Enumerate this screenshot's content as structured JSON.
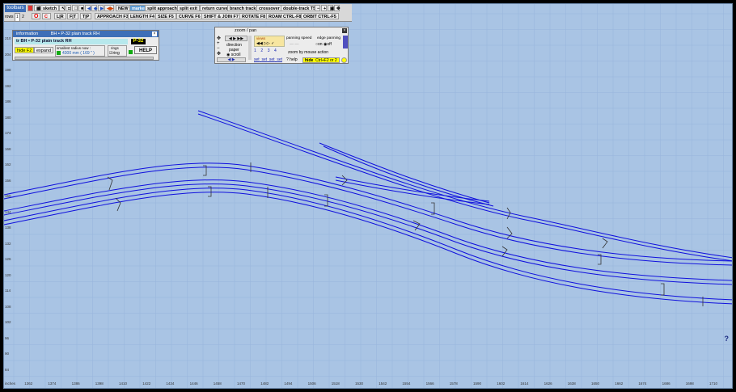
{
  "toolbar": {
    "title": "toolbars",
    "rows_label": "rows",
    "row_opts": [
      "1",
      "2"
    ],
    "sketch": "sketch",
    "new": "NEW",
    "marker": "marker",
    "split_approach": "split  approach",
    "split_exit": "split  exit",
    "return_curve": "return curve",
    "branch_track": "branch track",
    "crossover": "crossover",
    "double_track": "double-track  T5",
    "btn_o": "O",
    "btn_c": "C",
    "lr": "L|R",
    "fit": "F|T",
    "tip": "T|P",
    "approach": "APPROACH  F3",
    "length": "LENGTH  F4",
    "size": "SIZE  F5",
    "curve": "CURVE  F6",
    "shift_join": "SHIFT & JOIN  F7",
    "rotate": "ROTATE  F8",
    "roam": "ROAM  CTRL-F8",
    "orbit": "ORBIT  CTRL-F5"
  },
  "info": {
    "title": "information",
    "subtitle": "BH • P-32  plain track   RH",
    "line": "tr   BH • P-32  plain track   RH",
    "badge": "P-32",
    "hide": "hide  F2",
    "expand": "expand",
    "radius_label": "smallest  radius  now :",
    "radius_value": "4300 mm  ( 169 \" )",
    "rings_label": "rings",
    "ring": "ring",
    "help": "HELP"
  },
  "zoom": {
    "title": "zoom  /  pan",
    "direction": "direction",
    "paper": "paper",
    "scroll": "scroll",
    "views": "views",
    "panning_speed": "panning speed",
    "edge_panning": "edge panning",
    "on": "on",
    "off": "off",
    "set_labels": [
      "set",
      "set",
      "set",
      "set"
    ],
    "num_labels": [
      "1",
      "2",
      "3",
      "4"
    ],
    "zoom_by_mouse": "zoom  by  mouse  action",
    "help": "? help",
    "hide": "hide",
    "hide_key": "Ctrl+F2  or  2"
  },
  "ruler_x": [
    "inches",
    "1362",
    "1374",
    "1386",
    "1398",
    "1410",
    "1422",
    "1434",
    "1446",
    "1458",
    "1470",
    "1482",
    "1494",
    "1506",
    "1518",
    "1530",
    "1542",
    "1554",
    "1566",
    "1578",
    "1590",
    "1602",
    "1614",
    "1626",
    "1638",
    "1650",
    "1662",
    "1674",
    "1686",
    "1698",
    "1710",
    "1722"
  ],
  "ruler_y": [
    "210",
    "204",
    "198",
    "192",
    "186",
    "180",
    "174",
    "168",
    "162",
    "156",
    "150",
    "144",
    "138",
    "132",
    "126",
    "120",
    "114",
    "108",
    "102",
    "96",
    "90",
    "84"
  ],
  "help_mark": "?",
  "colors": {
    "canvas": "#a9c4e4",
    "rail": "#1010dd",
    "grid": "#8eacd6",
    "accent": "#3e6fb7"
  }
}
